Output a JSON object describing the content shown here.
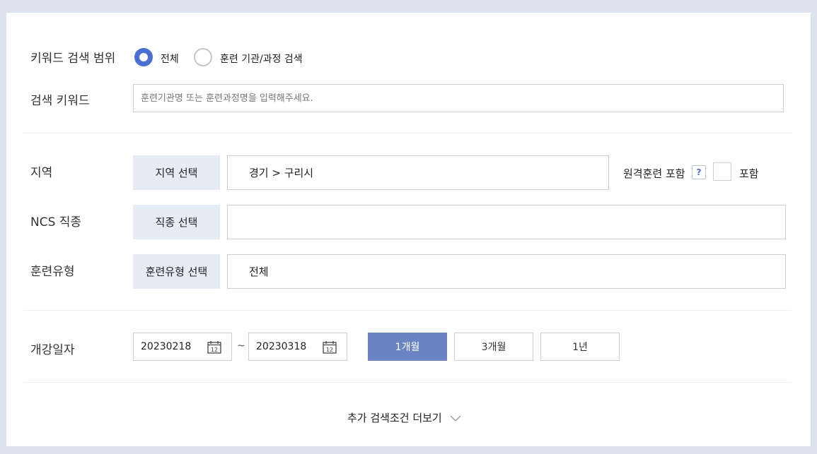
{
  "keyword_scope": {
    "label": "키워드 검색 범위",
    "options": [
      "전체",
      "훈련 기관/과정 검색"
    ],
    "selected": "전체"
  },
  "keyword": {
    "label": "검색 키워드",
    "placeholder": "훈련기관명 또는 훈련과정명을 입력해주세요.",
    "value": ""
  },
  "region": {
    "label": "지역",
    "button": "지역 선택",
    "value": "경기 > 구리시",
    "remote_label": "원격훈련 포함",
    "help": "?",
    "include_label": "포함"
  },
  "ncs": {
    "label": "NCS 직종",
    "button": "직종 선택",
    "value": ""
  },
  "training_type": {
    "label": "훈련유형",
    "button": "훈련유형 선택",
    "value": "전체"
  },
  "date": {
    "label": "개강일자",
    "start": "20230218",
    "tilde": "~",
    "end": "20230318",
    "calendar_day": "12",
    "periods": [
      "1개월",
      "3개월",
      "1년"
    ],
    "active_period": "1개월"
  },
  "more": {
    "label": "추가 검색조건 더보기"
  },
  "colors": {
    "accent": "#4a6fd0",
    "active_button": "#6b84c4",
    "select_button_bg": "#e6ecf5"
  }
}
